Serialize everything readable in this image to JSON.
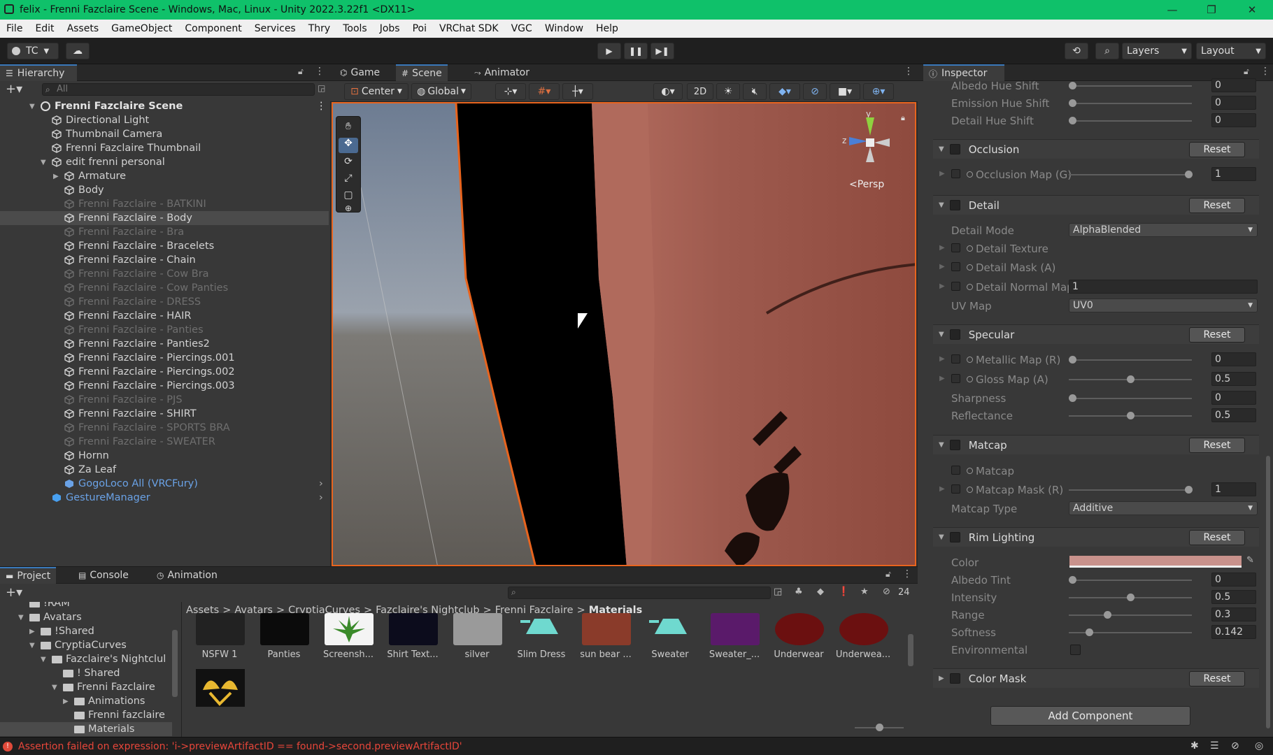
{
  "window": {
    "title": "felix - Frenni Fazclaire Scene - Windows, Mac, Linux - Unity 2022.3.22f1 <DX11>",
    "minimize": "—",
    "restore": "❐",
    "close": "✕"
  },
  "menu": [
    "File",
    "Edit",
    "Assets",
    "GameObject",
    "Component",
    "Services",
    "Thry",
    "Tools",
    "Jobs",
    "Poi",
    "VRChat SDK",
    "VGC",
    "Window",
    "Help"
  ],
  "toolbar": {
    "account": "TC",
    "layers": "Layers",
    "layout": "Layout"
  },
  "hierarchy": {
    "tab": "Hierarchy",
    "search_placeholder": "All",
    "scene": "Frenni Fazclaire Scene",
    "items": [
      {
        "label": "Directional Light",
        "indent": 1,
        "state": "normal"
      },
      {
        "label": "Thumbnail Camera",
        "indent": 1,
        "state": "normal"
      },
      {
        "label": "Frenni Fazclaire Thumbnail",
        "indent": 1,
        "state": "normal"
      },
      {
        "label": "edit frenni personal",
        "indent": 1,
        "state": "normal",
        "expanded": true
      },
      {
        "label": "Armature",
        "indent": 2,
        "state": "normal",
        "collapsed": true
      },
      {
        "label": "Body",
        "indent": 2,
        "state": "normal"
      },
      {
        "label": "Frenni Fazclaire - BATKINI",
        "indent": 2,
        "state": "dim"
      },
      {
        "label": "Frenni Fazclaire - Body",
        "indent": 2,
        "state": "selected"
      },
      {
        "label": "Frenni Fazclaire - Bra",
        "indent": 2,
        "state": "dim"
      },
      {
        "label": "Frenni Fazclaire - Bracelets",
        "indent": 2,
        "state": "normal"
      },
      {
        "label": "Frenni Fazclaire - Chain",
        "indent": 2,
        "state": "normal"
      },
      {
        "label": "Frenni Fazclaire - Cow Bra",
        "indent": 2,
        "state": "dim"
      },
      {
        "label": "Frenni Fazclaire - Cow Panties",
        "indent": 2,
        "state": "dim"
      },
      {
        "label": "Frenni Fazclaire - DRESS",
        "indent": 2,
        "state": "dim"
      },
      {
        "label": "Frenni Fazclaire - HAIR",
        "indent": 2,
        "state": "normal"
      },
      {
        "label": "Frenni Fazclaire - Panties",
        "indent": 2,
        "state": "dim"
      },
      {
        "label": "Frenni Fazclaire - Panties2",
        "indent": 2,
        "state": "normal"
      },
      {
        "label": "Frenni Fazclaire - Piercings.001",
        "indent": 2,
        "state": "normal"
      },
      {
        "label": "Frenni Fazclaire - Piercings.002",
        "indent": 2,
        "state": "normal"
      },
      {
        "label": "Frenni Fazclaire - Piercings.003",
        "indent": 2,
        "state": "normal"
      },
      {
        "label": "Frenni Fazclaire - PJS",
        "indent": 2,
        "state": "dim"
      },
      {
        "label": "Frenni Fazclaire - SHIRT",
        "indent": 2,
        "state": "normal"
      },
      {
        "label": "Frenni Fazclaire - SPORTS BRA",
        "indent": 2,
        "state": "dim"
      },
      {
        "label": "Frenni Fazclaire - SWEATER",
        "indent": 2,
        "state": "dim"
      },
      {
        "label": "Hornn",
        "indent": 2,
        "state": "normal"
      },
      {
        "label": "Za Leaf",
        "indent": 2,
        "state": "normal"
      },
      {
        "label": "GogoLoco All (VRCFury)",
        "indent": 2,
        "state": "blue"
      },
      {
        "label": "GestureManager",
        "indent": 1,
        "state": "blue"
      }
    ]
  },
  "scene_tabs": [
    "Game",
    "Scene",
    "Animator"
  ],
  "scene_toolbar": {
    "pivot": "Center",
    "space": "Global",
    "mode2d": "2D"
  },
  "scene_view": {
    "persp_label": "<Persp",
    "axis_y": "y",
    "axis_z": "z"
  },
  "project": {
    "tabs": [
      "Project",
      "Console",
      "Animation"
    ],
    "hidden_count": "24",
    "breadcrumb": [
      "Assets",
      "Avatars",
      "CryptiaCurves",
      "Fazclaire's Nightclub",
      "Frenni Fazclaire",
      "Materials"
    ],
    "tree": [
      {
        "label": "!RAM",
        "indent": 1
      },
      {
        "label": "Avatars",
        "indent": 1,
        "expanded": true
      },
      {
        "label": "!Shared",
        "indent": 2
      },
      {
        "label": "CryptiaCurves",
        "indent": 2,
        "expanded": true
      },
      {
        "label": "Fazclaire's Nightclul",
        "indent": 3,
        "expanded": true
      },
      {
        "label": "! Shared",
        "indent": 4
      },
      {
        "label": "Frenni Fazclaire",
        "indent": 4,
        "expanded": true
      },
      {
        "label": "Animations",
        "indent": 5
      },
      {
        "label": "Frenni fazclaire",
        "indent": 5
      },
      {
        "label": "Materials",
        "indent": 5
      }
    ],
    "assets": [
      {
        "label": "NSFW 1",
        "color": "#222222"
      },
      {
        "label": "Panties",
        "color": "#0b0b0b"
      },
      {
        "label": "Screensh...",
        "color": "#f4f4f4"
      },
      {
        "label": "Shirt Text...",
        "color": "#0c0c1c"
      },
      {
        "label": "silver",
        "color": "#9a9a9a"
      },
      {
        "label": "Slim Dress",
        "color": "#6fd9cf"
      },
      {
        "label": "sun bear ...",
        "color": "#8a3b2a"
      },
      {
        "label": "Sweater",
        "color": "#6fd9cf"
      },
      {
        "label": "Sweater_...",
        "color": "#5a1a6a"
      },
      {
        "label": "Underwear",
        "color": "#6b1010"
      },
      {
        "label": "Underwea...",
        "color": "#6b1010"
      }
    ]
  },
  "inspector": {
    "tab": "Inspector",
    "rows_top": [
      {
        "label": "Albedo Hue Shift",
        "value": "0",
        "fraction": 0
      },
      {
        "label": "Emission Hue Shift",
        "value": "0",
        "fraction": 0
      },
      {
        "label": "Detail Hue Shift",
        "value": "0",
        "fraction": 0
      }
    ],
    "reset_label": "Reset",
    "occlusion": {
      "title": "Occlusion",
      "map_label": "Occlusion Map (G)",
      "map_value": "1",
      "map_fraction": 1
    },
    "detail": {
      "title": "Detail",
      "mode_label": "Detail Mode",
      "mode_value": "AlphaBlended",
      "texture_label": "Detail Texture",
      "mask_label": "Detail Mask (A)",
      "normal_label": "Detail Normal Map",
      "normal_value": "1",
      "uv_label": "UV Map",
      "uv_value": "UV0"
    },
    "specular": {
      "title": "Specular",
      "metallic_label": "Metallic Map (R)",
      "metallic_value": "0",
      "metallic_fraction": 0,
      "gloss_label": "Gloss Map (A)",
      "gloss_value": "0.5",
      "gloss_fraction": 0.5,
      "sharpness_label": "Sharpness",
      "sharpness_value": "0",
      "sharpness_fraction": 0,
      "reflectance_label": "Reflectance",
      "reflectance_value": "0.5",
      "reflectance_fraction": 0.5
    },
    "matcap": {
      "title": "Matcap",
      "matcap_label": "Matcap",
      "mask_label": "Matcap Mask (R)",
      "mask_value": "1",
      "mask_fraction": 1,
      "type_label": "Matcap Type",
      "type_value": "Additive"
    },
    "rim": {
      "title": "Rim Lighting",
      "color_label": "Color",
      "color_hex": "#c9928c",
      "albedo_label": "Albedo Tint",
      "albedo_value": "0",
      "albedo_fraction": 0,
      "intensity_label": "Intensity",
      "intensity_value": "0.5",
      "intensity_fraction": 0.5,
      "range_label": "Range",
      "range_value": "0.3",
      "range_fraction": 0.3,
      "softness_label": "Softness",
      "softness_value": "0.142",
      "softness_fraction": 0.142,
      "env_label": "Environmental"
    },
    "colormask": {
      "title": "Color Mask"
    },
    "add_component": "Add Component"
  },
  "status": {
    "message": "Assertion failed on expression: 'i->previewArtifactID == found->second.previewArtifactID'"
  }
}
